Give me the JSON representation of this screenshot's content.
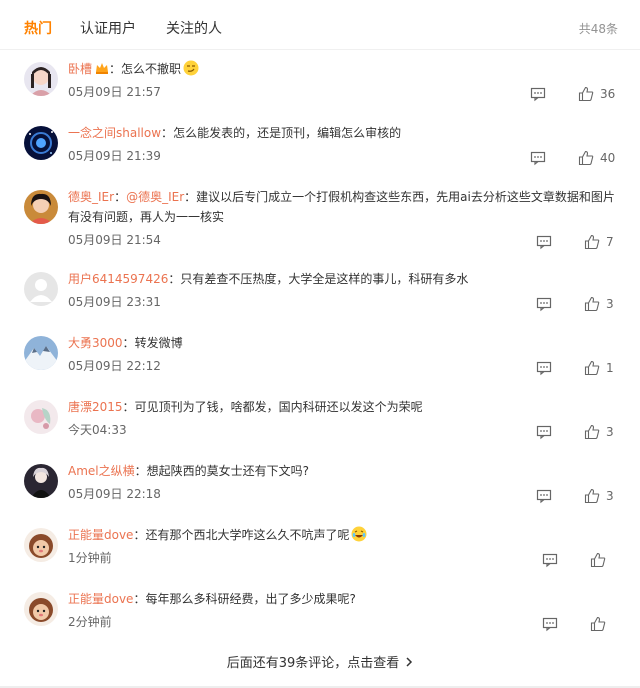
{
  "tabs": [
    {
      "label": "热门",
      "active": true
    },
    {
      "label": "认证用户",
      "active": false
    },
    {
      "label": "关注的人",
      "active": false
    }
  ],
  "total": "共48条",
  "comments": [
    {
      "user": "卧槽",
      "text": "怎么不撤职",
      "time": "05月09日 21:57",
      "likes": "36"
    },
    {
      "user": "一念之间shallow",
      "text": "怎么能发表的，还是顶刊，编辑怎么审核的",
      "time": "05月09日 21:39",
      "likes": "40"
    },
    {
      "user": "德奥_IEr",
      "mention": "@德奥_IEr",
      "text": "建议以后专门成立一个打假机构查这些东西，先用ai去分析这些文章数据和图片有没有问题，再人为一一核实",
      "time": "05月09日 21:54",
      "likes": "7"
    },
    {
      "user": "用户6414597426",
      "text": "只有差查不压热度，大学全是这样的事儿，科研有多水",
      "time": "05月09日 23:31",
      "likes": "3"
    },
    {
      "user": "大勇3000",
      "text": "转发微博",
      "time": "05月09日 22:12",
      "likes": "1"
    },
    {
      "user": "唐漂2015",
      "text": "可见顶刊为了钱，啥都发，国内科研还以发这个为荣呢",
      "time": "今天04:33",
      "likes": "3"
    },
    {
      "user": "Amel之纵横",
      "text": "想起陕西的莫女士还有下文吗?",
      "time": "05月09日 22:18",
      "likes": "3"
    },
    {
      "user": "正能量dove",
      "text": "还有那个西北大学咋这么久不吭声了呢",
      "time": "1分钟前",
      "likes": ""
    },
    {
      "user": "正能量dove",
      "text": "每年那么多科研经费，出了多少成果呢?",
      "time": "2分钟前",
      "likes": ""
    }
  ],
  "more_label": "后面还有39条评论，点击查看",
  "icons": {
    "reply": "comment-icon",
    "like": "thumbs-up-icon",
    "arrow": "chevron-right-icon",
    "badge": "crown-badge-icon"
  },
  "colors": {
    "accent": "#ff8200",
    "username": "#eb7350"
  }
}
